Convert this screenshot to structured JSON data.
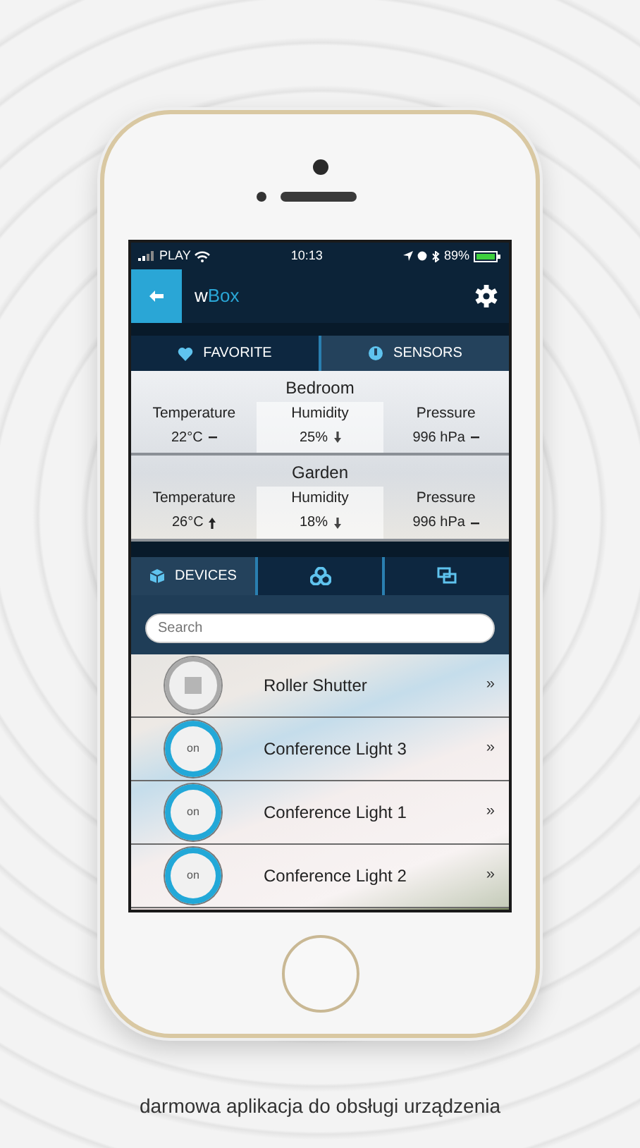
{
  "status_bar": {
    "carrier": "PLAY",
    "time": "10:13",
    "battery": "89%"
  },
  "app_bar": {
    "title_prefix": "w",
    "title_accent": "Box"
  },
  "top_tabs": [
    {
      "label": "FAVORITE",
      "selected": false
    },
    {
      "label": "SENSORS",
      "selected": true
    }
  ],
  "rooms": [
    {
      "name": "Bedroom",
      "readings": [
        {
          "label": "Temperature",
          "value": "22°C",
          "kind": "flat"
        },
        {
          "label": "Humidity",
          "value": "25%",
          "kind": "down"
        },
        {
          "label": "Pressure",
          "value": "996 hPa",
          "kind": "flat"
        }
      ]
    },
    {
      "name": "Garden",
      "readings": [
        {
          "label": "Temperature",
          "value": "26°C",
          "kind": "up"
        },
        {
          "label": "Humidity",
          "value": "18%",
          "kind": "down"
        },
        {
          "label": "Pressure",
          "value": "996 hPa",
          "kind": "flat"
        }
      ]
    }
  ],
  "bottom_tabs": [
    {
      "label": "DEVICES",
      "selected": true
    },
    {
      "selected": false
    },
    {
      "selected": false
    }
  ],
  "search": {
    "placeholder": "Search"
  },
  "devices": [
    {
      "kind": "shutter",
      "name": "Roller Shutter",
      "chevron": "»"
    },
    {
      "kind": "light",
      "state": "on",
      "name": "Conference Light 3",
      "chevron": "»"
    },
    {
      "kind": "light",
      "state": "on",
      "name": "Conference Light 1",
      "chevron": "»"
    },
    {
      "kind": "light",
      "state": "on",
      "name": "Conference Light 2",
      "chevron": "»"
    }
  ],
  "caption": "darmowa aplikacja do obsługi urządzenia"
}
